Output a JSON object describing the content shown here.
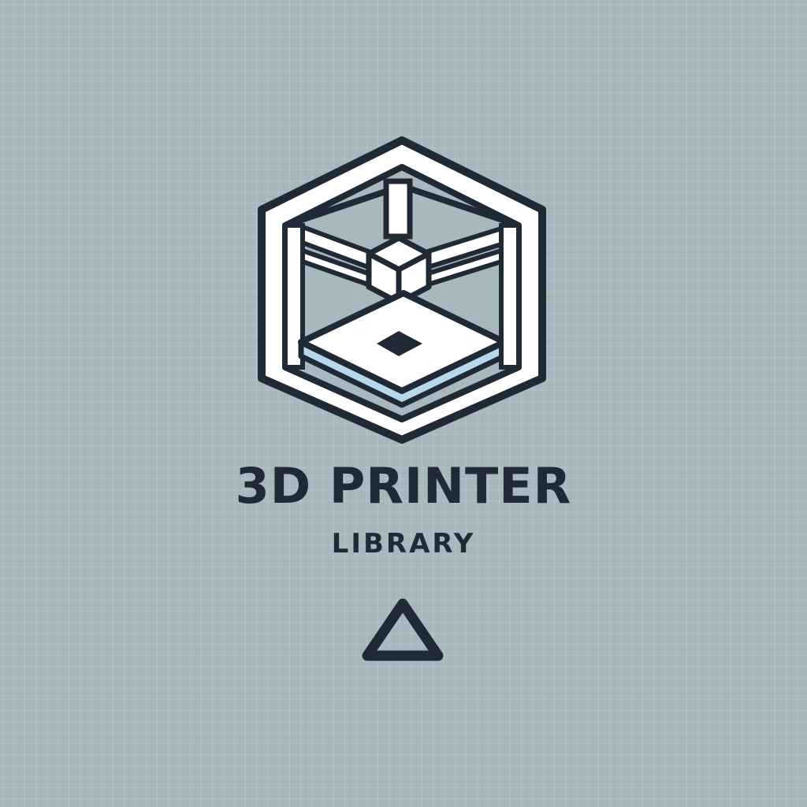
{
  "logo": {
    "title": "3D PRINTER",
    "subtitle": "LIBRARY",
    "mark_icon": "3d-printer-cube-icon",
    "accent_icon": "triangle-outline-icon"
  },
  "colors": {
    "background": "#a9b8bf",
    "ink": "#1f2a36",
    "fill_white": "#ffffff",
    "accent_blue": "#b9d7ea"
  }
}
